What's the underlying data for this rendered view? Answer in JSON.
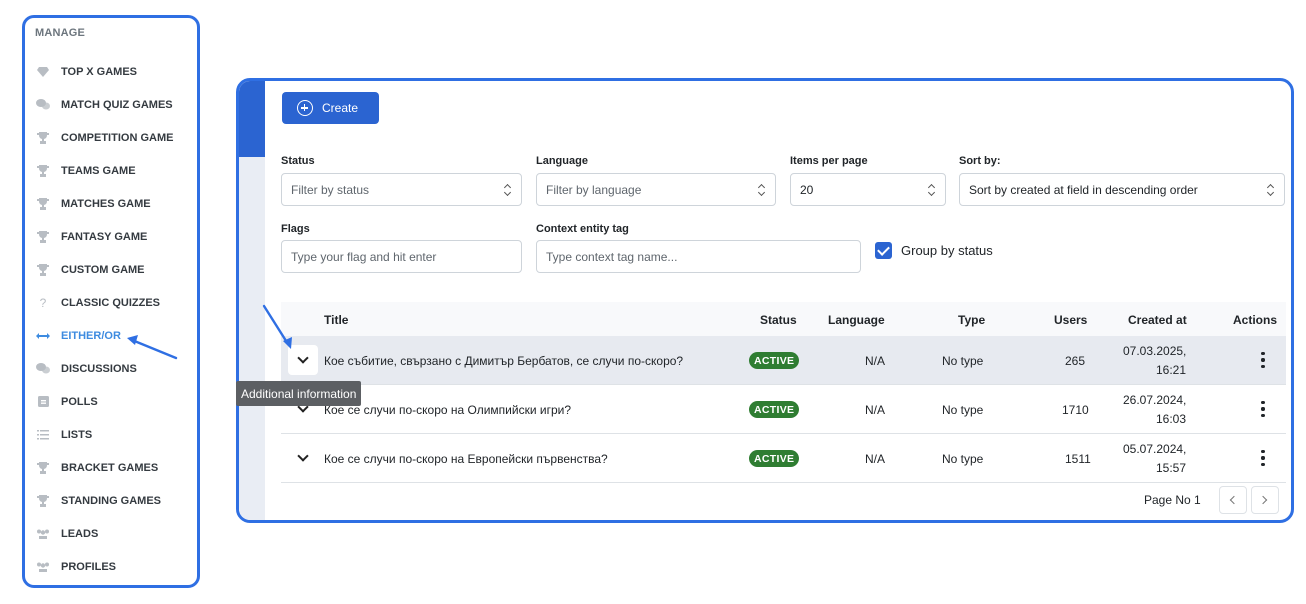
{
  "sidebar": {
    "heading": "MANAGE",
    "items": [
      {
        "label": "TOP X GAMES",
        "icon": "diamond-icon"
      },
      {
        "label": "MATCH QUIZ GAMES",
        "icon": "chat-bubbles-icon"
      },
      {
        "label": "COMPETITION GAME",
        "icon": "trophy-icon"
      },
      {
        "label": "TEAMS GAME",
        "icon": "trophy-icon"
      },
      {
        "label": "MATCHES GAME",
        "icon": "trophy-icon"
      },
      {
        "label": "FANTASY GAME",
        "icon": "trophy-icon"
      },
      {
        "label": "CUSTOM GAME",
        "icon": "trophy-icon"
      },
      {
        "label": "CLASSIC QUIZZES",
        "icon": "question-icon"
      },
      {
        "label": "EITHER/OR",
        "icon": "double-arrow-icon",
        "active": true
      },
      {
        "label": "DISCUSSIONS",
        "icon": "chat-bubbles-icon"
      },
      {
        "label": "POLLS",
        "icon": "poll-box-icon"
      },
      {
        "label": "LISTS",
        "icon": "list-icon"
      },
      {
        "label": "BRACKET GAMES",
        "icon": "trophy-icon"
      },
      {
        "label": "STANDING GAMES",
        "icon": "trophy-icon"
      },
      {
        "label": "LEADS",
        "icon": "people-icon"
      },
      {
        "label": "PROFILES",
        "icon": "people-icon"
      }
    ]
  },
  "toolbar": {
    "create_label": "Create"
  },
  "filters": {
    "status": {
      "label": "Status",
      "placeholder": "Filter by status"
    },
    "language": {
      "label": "Language",
      "placeholder": "Filter by language"
    },
    "items_per_page": {
      "label": "Items per page",
      "value": "20"
    },
    "sort_by": {
      "label": "Sort by:",
      "value": "Sort by created at field in descending order"
    },
    "flags": {
      "label": "Flags",
      "placeholder": "Type your flag and hit enter"
    },
    "context_tag": {
      "label": "Context entity tag",
      "placeholder": "Type context tag name..."
    },
    "group_by_status": {
      "label": "Group by status",
      "checked": true
    }
  },
  "table": {
    "headers": {
      "title": "Title",
      "status": "Status",
      "language": "Language",
      "type": "Type",
      "users": "Users",
      "created_at": "Created at",
      "actions": "Actions"
    },
    "rows": [
      {
        "title": "Кое събитие, свързано с Димитър Бербатов, се случи по-скоро?",
        "status": "ACTIVE",
        "language": "N/A",
        "type": "No type",
        "users": "265",
        "date": "07.03.2025,",
        "time": "16:21"
      },
      {
        "title": "Кое се случи по-скоро на Олимпийски игри?",
        "status": "ACTIVE",
        "language": "N/A",
        "type": "No type",
        "users": "1710",
        "date": "26.07.2024,",
        "time": "16:03"
      },
      {
        "title": "Кое се случи по-скоро на Европейски първенства?",
        "status": "ACTIVE",
        "language": "N/A",
        "type": "No type",
        "users": "1511",
        "date": "05.07.2024,",
        "time": "15:57"
      }
    ]
  },
  "pagination": {
    "text": "Page No 1"
  },
  "tooltip": {
    "text": "Additional information"
  },
  "colors": {
    "accent": "#2b64d1",
    "annotation": "#2f6fe3",
    "badge": "#2f7d32",
    "active_nav": "#3d8be0"
  }
}
